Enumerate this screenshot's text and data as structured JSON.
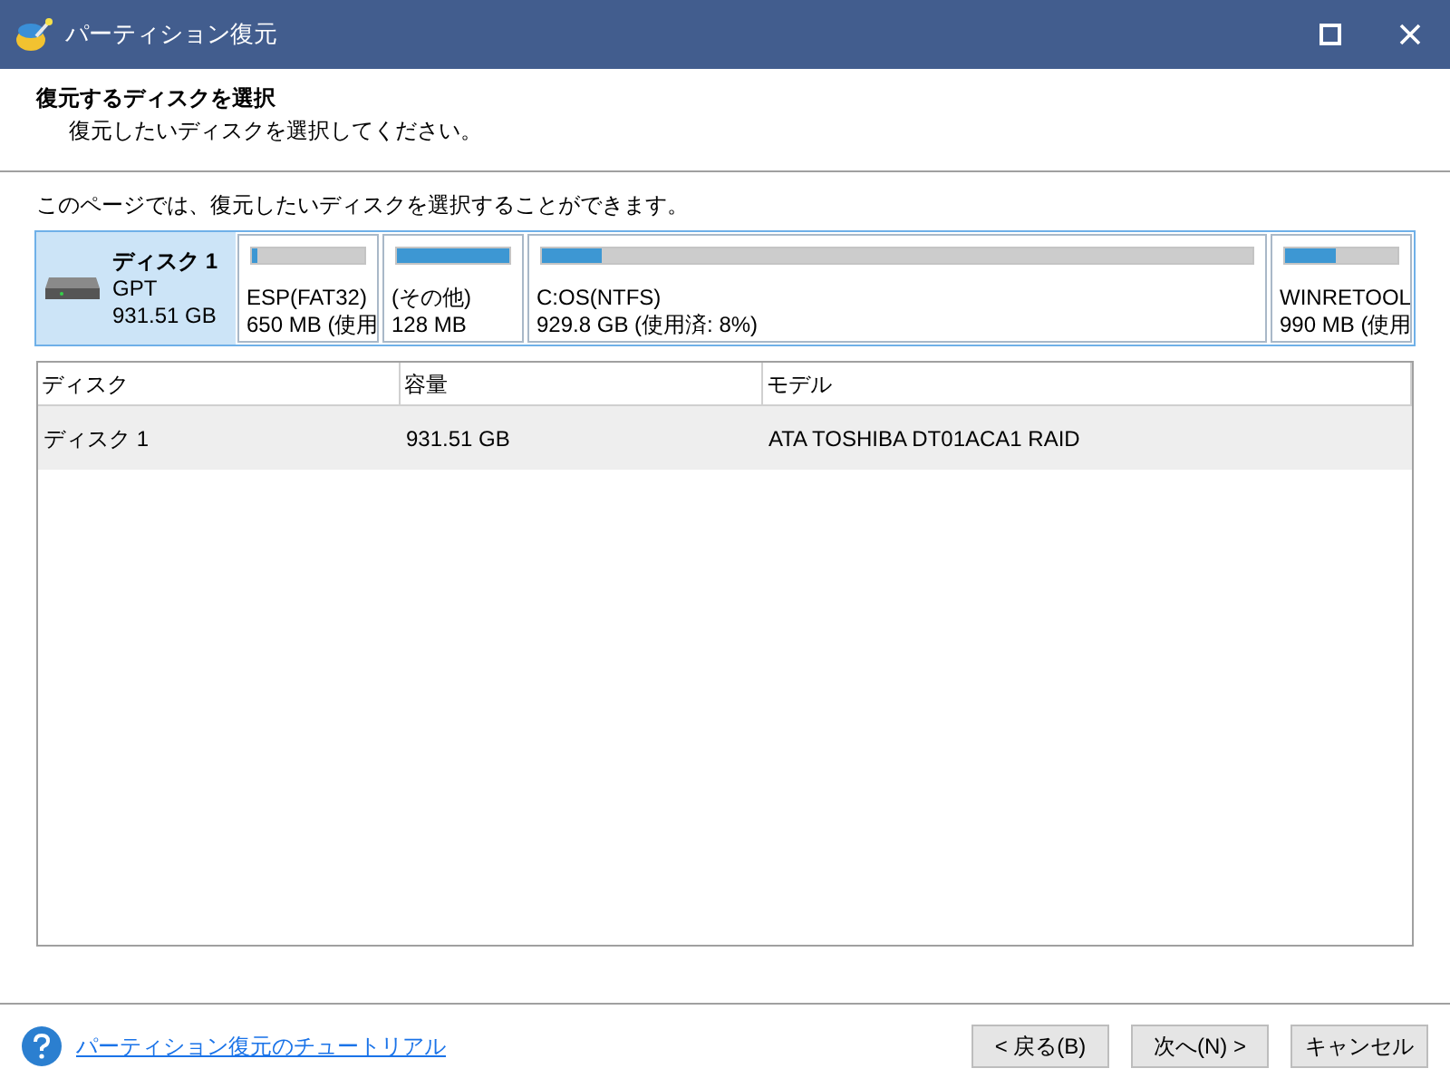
{
  "window": {
    "title": "パーティション復元"
  },
  "header": {
    "title": "復元するディスクを選択",
    "subtitle": "復元したいディスクを選択してください。"
  },
  "description": "このページでは、復元したいディスクを選択することができます。",
  "disk_map": {
    "disk": {
      "name": "ディスク 1",
      "type": "GPT",
      "size": "931.51 GB",
      "selected": true
    },
    "partitions": [
      {
        "name": "ESP(FAT32)",
        "info": "650 MB (使用",
        "level": 0.05
      },
      {
        "name": "(その他)",
        "info": "128 MB",
        "level": 1
      },
      {
        "name": "C:OS(NTFS)",
        "info": "929.8 GB (使用済: 8%)",
        "level": 0.085
      },
      {
        "name": "WINRETOOL",
        "info": "990 MB (使用",
        "level": 0.45
      }
    ]
  },
  "table": {
    "columns": [
      "ディスク",
      "容量",
      "モデル"
    ],
    "rows": [
      {
        "cells": [
          "ディスク 1",
          "931.51 GB",
          "ATA TOSHIBA DT01ACA1 RAID"
        ],
        "selected": true
      }
    ]
  },
  "footer": {
    "help_link": "パーティション復元のチュートリアル",
    "buttons": [
      "< 戻る(B)",
      "次へ(N) >",
      "キャンセル"
    ]
  }
}
